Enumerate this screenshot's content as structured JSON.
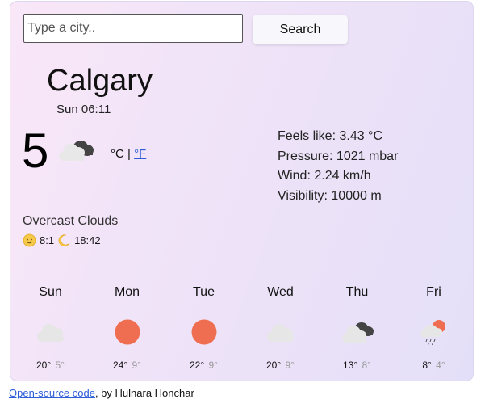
{
  "search": {
    "placeholder": "Type a city..",
    "button_label": "Search"
  },
  "current": {
    "city": "Calgary",
    "datetime": "Sun 06:11",
    "temperature": "5",
    "unit_c": "°C",
    "separator": "|",
    "unit_f": "°F",
    "icon": "overcast-clouds-icon",
    "description": "Overcast Clouds",
    "sunrise": "8:1",
    "sunset": "18:42",
    "details": {
      "feels_like": "Feels like: 3.43 °C",
      "pressure": "Pressure: 1021 mbar",
      "wind": "Wind: 2.24 km/h",
      "visibility": "Visibility: 10000 m"
    }
  },
  "forecast": [
    {
      "day": "Sun",
      "icon": "cloud-icon",
      "max": "20°",
      "min": "5°"
    },
    {
      "day": "Mon",
      "icon": "sun-icon",
      "max": "24°",
      "min": "9°"
    },
    {
      "day": "Tue",
      "icon": "sun-icon",
      "max": "22°",
      "min": "9°"
    },
    {
      "day": "Wed",
      "icon": "cloud-icon",
      "max": "20°",
      "min": "9°"
    },
    {
      "day": "Thu",
      "icon": "overcast-clouds-icon",
      "max": "13°",
      "min": "8°"
    },
    {
      "day": "Fri",
      "icon": "sun-rain-icon",
      "max": "8°",
      "min": "4°"
    }
  ],
  "footer": {
    "link_text": "Open-source code",
    "author_text": ", by Hulnara Honchar"
  },
  "colors": {
    "sun": "#ef6d50",
    "cloud_light": "#e2e2e2",
    "cloud_dark": "#444444",
    "link": "#2f5dd8"
  }
}
